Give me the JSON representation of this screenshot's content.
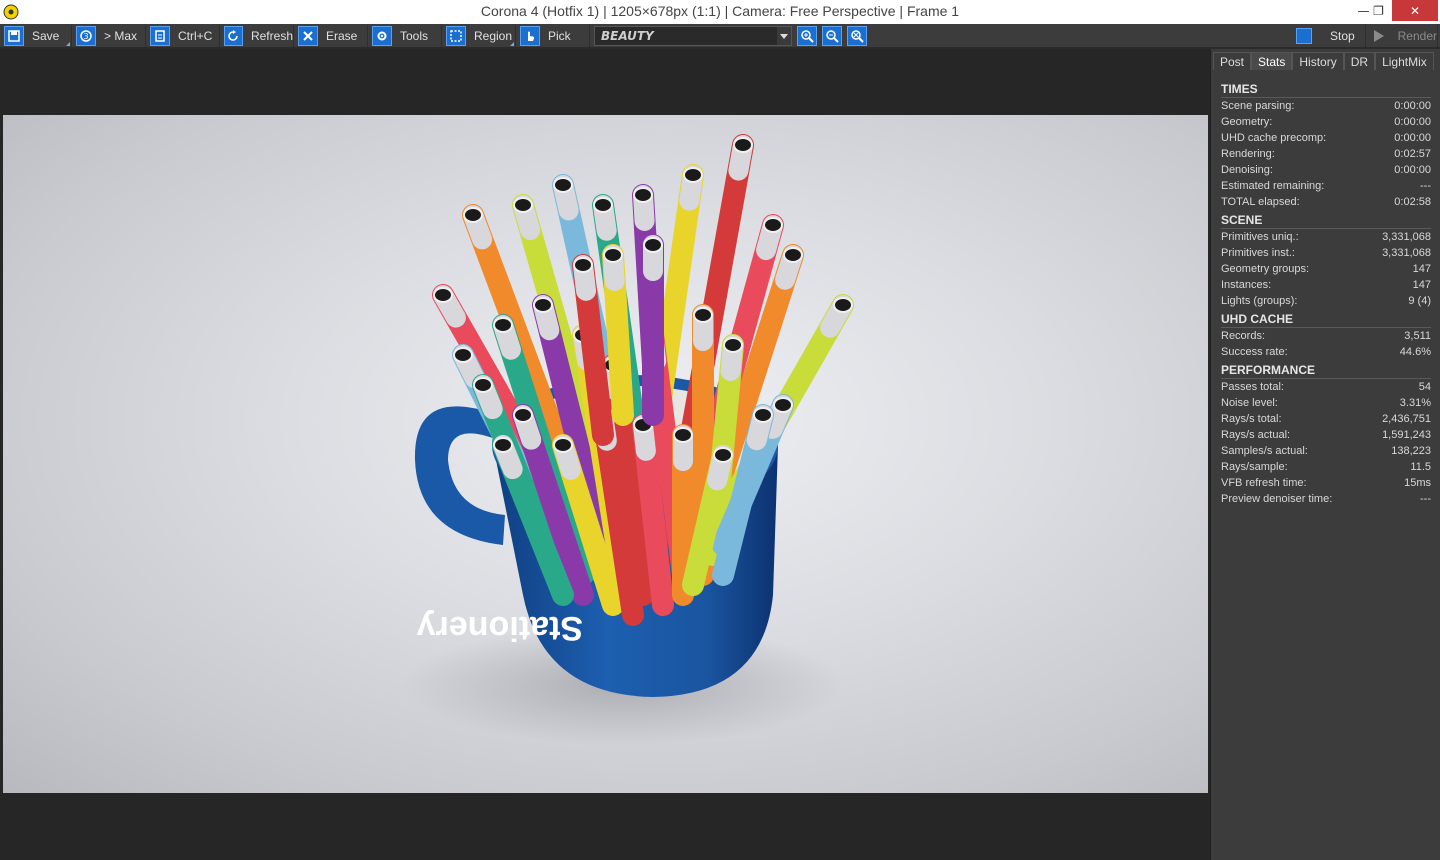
{
  "window": {
    "title": "Corona 4 (Hotfix 1) | 1205×678px (1:1) | Camera: Free Perspective | Frame 1",
    "close_glyph": "✕",
    "restore_glyph": "❐",
    "minimize_glyph": "—"
  },
  "toolbar": {
    "save": "Save",
    "to_max": "> Max",
    "copy": "Ctrl+C",
    "refresh": "Refresh",
    "erase": "Erase",
    "tools": "Tools",
    "region": "Region",
    "pick": "Pick",
    "channel": "BEAUTY",
    "stop": "Stop",
    "render": "Render"
  },
  "tabs": [
    "Post",
    "Stats",
    "History",
    "DR",
    "LightMix"
  ],
  "active_tab": "Stats",
  "stats": {
    "times": {
      "title": "TIMES",
      "rows": [
        {
          "label": "Scene parsing:",
          "value": "0:00:00"
        },
        {
          "label": "Geometry:",
          "value": "0:00:00"
        },
        {
          "label": "UHD cache precomp:",
          "value": "0:00:00"
        },
        {
          "label": "Rendering:",
          "value": "0:02:57"
        },
        {
          "label": "Denoising:",
          "value": "0:00:00"
        },
        {
          "label": "Estimated remaining:",
          "value": "---"
        },
        {
          "label": "TOTAL elapsed:",
          "value": "0:02:58"
        }
      ]
    },
    "scene": {
      "title": "SCENE",
      "rows": [
        {
          "label": "Primitives uniq.:",
          "value": "3,331,068"
        },
        {
          "label": "Primitives inst.:",
          "value": "3,331,068"
        },
        {
          "label": "Geometry groups:",
          "value": "147"
        },
        {
          "label": "Instances:",
          "value": "147"
        },
        {
          "label": "Lights (groups):",
          "value": "9 (4)"
        }
      ]
    },
    "uhd": {
      "title": "UHD CACHE",
      "rows": [
        {
          "label": "Records:",
          "value": "3,511"
        },
        {
          "label": "Success rate:",
          "value": "44.6%"
        }
      ]
    },
    "performance": {
      "title": "PERFORMANCE",
      "rows": [
        {
          "label": "Passes total:",
          "value": "54"
        },
        {
          "label": "Noise level:",
          "value": "3.31%"
        },
        {
          "label": "Rays/s total:",
          "value": "2,436,751"
        },
        {
          "label": "Rays/s actual:",
          "value": "1,591,243"
        },
        {
          "label": "Samples/s actual:",
          "value": "138,223"
        },
        {
          "label": "Rays/sample:",
          "value": "11.5"
        },
        {
          "label": "VFB refresh time:",
          "value": "15ms"
        },
        {
          "label": "Preview denoiser time:",
          "value": "---"
        }
      ]
    }
  },
  "render_image": {
    "mug_logo": "Stationery",
    "colors": {
      "mug": "#1d5fb0",
      "pen_colors": [
        "#e94a5c",
        "#f08a2a",
        "#c8dc3a",
        "#7ab8dc",
        "#2aa88a",
        "#8a3aa8",
        "#e8d42a",
        "#d43a3a"
      ]
    }
  }
}
